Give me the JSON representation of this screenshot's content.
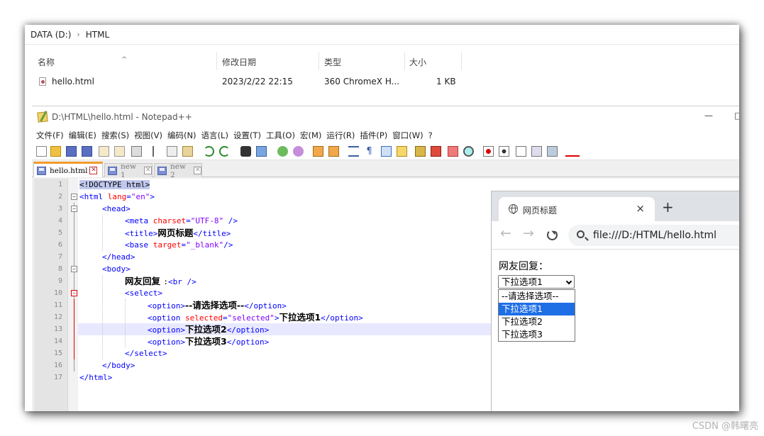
{
  "explorer": {
    "breadcrumb": [
      "DATA (D:)",
      "HTML"
    ],
    "columns": [
      "名称",
      "修改日期",
      "类型",
      "大小"
    ],
    "file": {
      "name": "hello.html",
      "modified": "2023/2/22 22:15",
      "type": "360 ChromeX H...",
      "size": "1 KB"
    }
  },
  "notepad": {
    "title": "D:\\HTML\\hello.html - Notepad++",
    "menu": [
      "文件(F)",
      "编辑(E)",
      "搜索(S)",
      "视图(V)",
      "编码(N)",
      "语言(L)",
      "设置(T)",
      "工具(O)",
      "宏(M)",
      "运行(R)",
      "插件(P)",
      "窗口(W)",
      "?"
    ],
    "tabs": [
      {
        "label": "hello.html",
        "active": true
      },
      {
        "label": "new 1",
        "active": false
      },
      {
        "label": "new 2",
        "active": false
      }
    ],
    "line_numbers": [
      "1",
      "2",
      "3",
      "4",
      "5",
      "6",
      "7",
      "8",
      "9",
      "10",
      "11",
      "12",
      "13",
      "14",
      "15",
      "16",
      "17"
    ],
    "code": {
      "l1": "<!DOCTYPE html>",
      "l2a": "<html ",
      "l2b": "lang",
      "l2c": "=",
      "l2d": "\"en\"",
      "l2e": ">",
      "l3": "<head>",
      "l4a": "<meta ",
      "l4b": "charset",
      "l4c": "=",
      "l4d": "\"UTF-8\"",
      "l4e": " />",
      "l5a": "<title>",
      "l5b": "网页标题",
      "l5c": "</title>",
      "l6a": "<base ",
      "l6b": "target",
      "l6c": "=",
      "l6d": "\"_blank\"",
      "l6e": "/>",
      "l7": "</head>",
      "l8": "<body>",
      "l9a": "网友回复 ",
      "l9b": ":",
      "l9c": "<br />",
      "l10": "<select>",
      "l11a": "<option>",
      "l11b": "--请选择选项--",
      "l11c": "</option>",
      "l12a": "<option ",
      "l12b": "selected",
      "l12c": "=",
      "l12d": "\"selected\"",
      "l12e": ">",
      "l12f": "下拉选项1",
      "l12g": "</option>",
      "l13a": "<option>",
      "l13b": "下拉选项2",
      "l13c": "</option>",
      "l14a": "<option>",
      "l14b": "下拉选项3",
      "l14c": "</option>",
      "l15": "</select>",
      "l16": "</body>",
      "l17": "</html>"
    }
  },
  "browser": {
    "tab_title": "网页标题",
    "tab_close": "×",
    "new_tab": "+",
    "url": "file:///D:/HTML/hello.html",
    "label": "网友回复：",
    "select_value": "下拉选项1",
    "options": [
      "--请选择选项--",
      "下拉选项1",
      "下拉选项2",
      "下拉选项3"
    ],
    "highlighted_option": 1
  },
  "watermark": "CSDN @韩曙亮",
  "colors": {
    "tag": "#0000ff",
    "attr": "#ff0000",
    "value": "#8000ff",
    "selection": "#1e6ee6",
    "tab_accent": "#f29a2a"
  }
}
